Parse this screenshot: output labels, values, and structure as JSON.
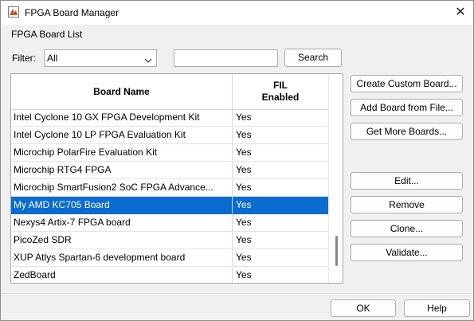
{
  "window": {
    "title": "FPGA Board Manager",
    "close_glyph": "✕"
  },
  "board_list": {
    "group_label": "FPGA Board List",
    "filter_label": "Filter:",
    "filter_value": "All",
    "search_value": "",
    "search_label": "Search",
    "columns": {
      "name": "Board Name",
      "fil_line1": "FIL",
      "fil_line2": "Enabled"
    },
    "rows": [
      {
        "name": "Intel Cyclone 10 GX FPGA Development Kit",
        "fil": "Yes"
      },
      {
        "name": "Intel Cyclone 10 LP FPGA Evaluation Kit",
        "fil": "Yes"
      },
      {
        "name": "Microchip PolarFire Evaluation Kit",
        "fil": "Yes"
      },
      {
        "name": "Microchip RTG4 FPGA",
        "fil": "Yes"
      },
      {
        "name": "Microchip SmartFusion2 SoC FPGA Advance...",
        "fil": "Yes"
      },
      {
        "name": "My AMD KC705 Board",
        "fil": "Yes"
      },
      {
        "name": "Nexys4 Artix-7 FPGA board",
        "fil": "Yes"
      },
      {
        "name": "PicoZed SDR",
        "fil": "Yes"
      },
      {
        "name": "XUP Atlys Spartan-6 development board",
        "fil": "Yes"
      },
      {
        "name": "ZedBoard",
        "fil": "Yes"
      }
    ],
    "selected_row": "My AMD KC705 Board",
    "scroll_position": "bottom"
  },
  "actions": {
    "create_custom": "Create Custom Board...",
    "add_from_file": "Add Board from File...",
    "get_more": "Get More Boards...",
    "edit": "Edit...",
    "remove": "Remove",
    "clone": "Clone...",
    "validate": "Validate..."
  },
  "footer": {
    "ok": "OK",
    "help": "Help"
  },
  "colors": {
    "selection": "#0a6ccf",
    "window_bg": "#f0f0f0"
  }
}
